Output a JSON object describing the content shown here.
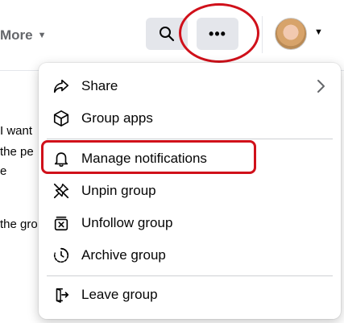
{
  "topbar": {
    "more_label": "More",
    "more_caret_icon": "caret-down-icon",
    "search_icon": "search-icon",
    "options_icon": "more-options-icon",
    "options_glyph": "•••",
    "account_caret_icon": "caret-down-icon"
  },
  "feed": {
    "lines": [
      "I want",
      "the pe",
      "e",
      "the gro"
    ]
  },
  "menu": {
    "items": [
      {
        "label": "Share",
        "icon": "share-icon",
        "has_submenu": true
      },
      {
        "label": "Group apps",
        "icon": "cube-icon"
      },
      {
        "label": "Manage notifications",
        "icon": "bell-icon"
      },
      {
        "label": "Unpin group",
        "icon": "unpin-icon"
      },
      {
        "label": "Unfollow group",
        "icon": "unfollow-icon"
      },
      {
        "label": "Archive group",
        "icon": "archive-icon"
      },
      {
        "label": "Leave group",
        "icon": "leave-icon"
      }
    ]
  },
  "annotations": {
    "highlight_color": "#d0101a"
  }
}
